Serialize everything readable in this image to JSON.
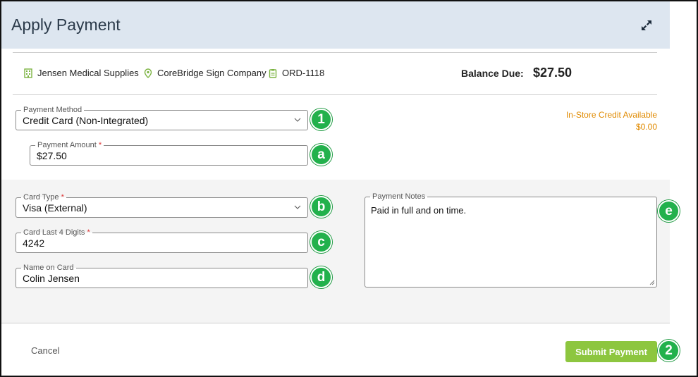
{
  "header": {
    "title": "Apply Payment"
  },
  "info": {
    "company": "Jensen Medical Supplies",
    "location": "CoreBridge Sign Company",
    "order": "ORD-1118",
    "balance_label": "Balance Due:",
    "balance_value": "$27.50"
  },
  "payment_method": {
    "label": "Payment Method",
    "value": "Credit Card (Non-Integrated)"
  },
  "payment_amount": {
    "label": "Payment Amount",
    "required": "*",
    "value": "$27.50"
  },
  "credit": {
    "label": "In-Store Credit Available",
    "value": "$0.00"
  },
  "card_type": {
    "label": "Card Type",
    "required": "*",
    "value": "Visa (External)"
  },
  "card_last4": {
    "label": "Card Last 4 Digits",
    "required": "*",
    "value": "4242"
  },
  "name_on_card": {
    "label": "Name on Card",
    "value": "Colin Jensen"
  },
  "notes": {
    "label": "Payment Notes",
    "value": "Paid in full and on time."
  },
  "badges": {
    "b1": "1",
    "ba": "a",
    "bb": "b",
    "bc": "c",
    "bd": "d",
    "be": "e",
    "b2": "2"
  },
  "footer": {
    "cancel": "Cancel",
    "submit": "Submit Payment"
  },
  "colors": {
    "header_bg": "#dde6f0",
    "accent_green": "#8dc63f",
    "badge_green": "#22b14c",
    "credit_orange": "#e08a00",
    "icon_green": "#7cb342"
  },
  "icons": {
    "company": "building-icon",
    "location": "map-pin-icon",
    "order": "clipboard-icon",
    "expand": "expand-icon",
    "dropdown": "chevron-down-icon"
  }
}
